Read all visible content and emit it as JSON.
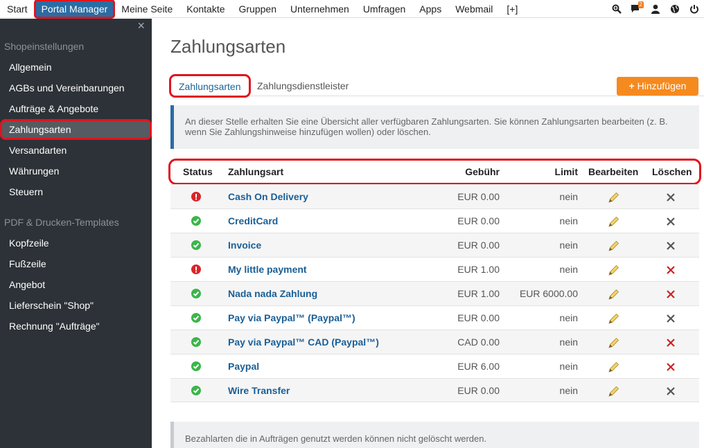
{
  "topnav": {
    "items": [
      "Start",
      "Portal Manager",
      "Meine Seite",
      "Kontakte",
      "Gruppen",
      "Unternehmen",
      "Umfragen",
      "Apps",
      "Webmail",
      "[+]"
    ],
    "notification_count": "2"
  },
  "sidebar": {
    "close": "×",
    "section1": "Shopeinstellungen",
    "items1": [
      "Allgemein",
      "AGBs und Vereinbarungen",
      "Aufträge & Angebote",
      "Zahlungsarten",
      "Versandarten",
      "Währungen",
      "Steuern"
    ],
    "section2": "PDF & Drucken-Templates",
    "items2": [
      "Kopfzeile",
      "Fußzeile",
      "Angebot",
      "Lieferschein \"Shop\"",
      "Rechnung \"Aufträge\""
    ]
  },
  "main": {
    "title": "Zahlungsarten",
    "tabs": [
      "Zahlungsarten",
      "Zahlungsdienstleister"
    ],
    "add_button": "Hinzufügen",
    "info": "An dieser Stelle erhalten Sie eine Übersicht aller verfügbaren Zahlungsarten. Sie können Zahlungsarten bearbeiten (z. B. wenn Sie Zahlungshinweise hinzufügen wollen) oder löschen.",
    "headers": {
      "status": "Status",
      "name": "Zahlungsart",
      "fee": "Gebühr",
      "limit": "Limit",
      "edit": "Bearbeiten",
      "delete": "Löschen"
    },
    "rows": [
      {
        "status": "error",
        "name": "Cash On Delivery",
        "fee": "EUR 0.00",
        "limit": "nein",
        "delete_color": "#555555"
      },
      {
        "status": "ok",
        "name": "CreditCard",
        "fee": "EUR 0.00",
        "limit": "nein",
        "delete_color": "#555555"
      },
      {
        "status": "ok",
        "name": "Invoice",
        "fee": "EUR 0.00",
        "limit": "nein",
        "delete_color": "#555555"
      },
      {
        "status": "error",
        "name": "My little payment",
        "fee": "EUR 1.00",
        "limit": "nein",
        "delete_color": "#cc2222"
      },
      {
        "status": "ok",
        "name": "Nada nada Zahlung",
        "fee": "EUR 1.00",
        "limit": "EUR 6000.00",
        "delete_color": "#cc2222"
      },
      {
        "status": "ok",
        "name": "Pay via Paypal™ (Paypal™)",
        "fee": "EUR 0.00",
        "limit": "nein",
        "delete_color": "#555555"
      },
      {
        "status": "ok",
        "name": "Pay via Paypal™ CAD (Paypal™)",
        "fee": "CAD 0.00",
        "limit": "nein",
        "delete_color": "#cc2222"
      },
      {
        "status": "ok",
        "name": "Paypal",
        "fee": "EUR 6.00",
        "limit": "nein",
        "delete_color": "#cc2222"
      },
      {
        "status": "ok",
        "name": "Wire Transfer",
        "fee": "EUR 0.00",
        "limit": "nein",
        "delete_color": "#555555"
      }
    ],
    "footer_note": "Bezahlarten die in Aufträgen genutzt werden können nicht gelöscht werden."
  },
  "colors": {
    "accent": "#2b6ca3",
    "sidebar_bg": "#2c3237",
    "add_button": "#f58a1f",
    "status_ok": "#3bb54a",
    "status_error": "#d9252a",
    "highlight": "#e0141e"
  }
}
